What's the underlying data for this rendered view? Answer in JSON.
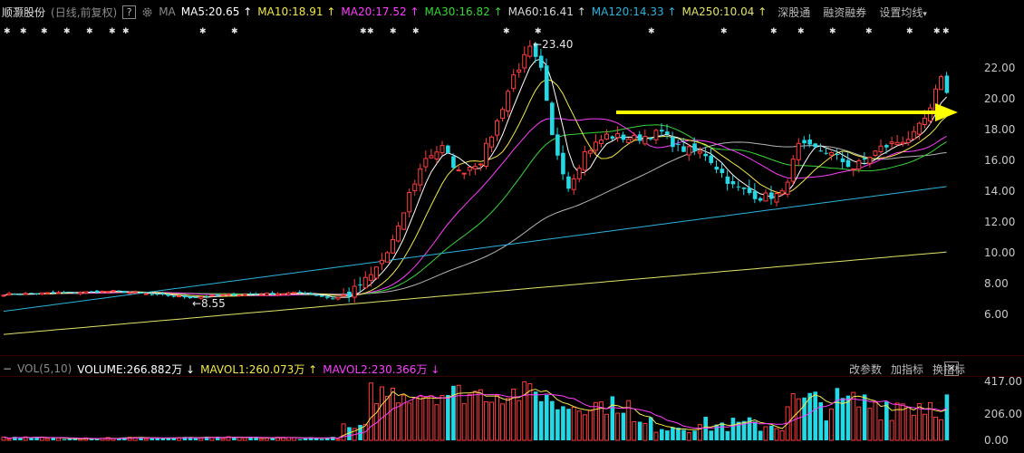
{
  "header": {
    "stock_name": "顺灏股份",
    "period": "(日线,前复权)",
    "help": "?",
    "gear": "gear-icon",
    "ma_label": "MA",
    "ma5": "MA5:20.65",
    "ma10": "MA10:18.91",
    "ma20": "MA20:17.52",
    "ma30": "MA30:16.82",
    "ma60": "MA60:16.41",
    "ma120": "MA120:14.33",
    "ma250": "MA250:10.04",
    "up_arrow": "↑",
    "btn1": "深股通",
    "btn2": "融资融券",
    "btn3": "设置均线",
    "btn3_caret": "▾"
  },
  "vol_header": {
    "collapse": "−",
    "label": "VOL(5,10)",
    "volume": "VOLUME:266.882万",
    "volume_arrow": "↓",
    "mavol1": "MAVOL1:260.073万",
    "mavol1_arrow": "↑",
    "mavol2": "MAVOL2:230.366万",
    "mavol2_arrow": "↓",
    "btn1": "改参数",
    "btn2": "加指标",
    "btn3": "换指标",
    "close": "✕"
  },
  "colors": {
    "up": "#ff3c3c",
    "down": "#24d9e6",
    "ma5": "#ffffff",
    "ma10": "#f3e84a",
    "ma20": "#ff3cff",
    "ma30": "#37d637",
    "ma60": "#b5b5b5",
    "ma120": "#2bb4dc",
    "ma250": "#e2e26a",
    "arrow": "#ffff00"
  },
  "chart_data": {
    "type": "candlestick",
    "price_axis": {
      "ylim": [
        5.0,
        23.8
      ],
      "ticks": [
        "22.00",
        "20.00",
        "18.00",
        "16.00",
        "14.00",
        "12.00",
        "10.00",
        "8.00",
        "6.00"
      ]
    },
    "volume_axis": {
      "ticks": [
        "417.00",
        "206.00",
        "0.00"
      ]
    },
    "annotations": {
      "high": "←23.40",
      "low": "←8.55",
      "star": "✱"
    },
    "note_arrow": {
      "from_value": 18.95,
      "to_value": 18.95
    }
  }
}
